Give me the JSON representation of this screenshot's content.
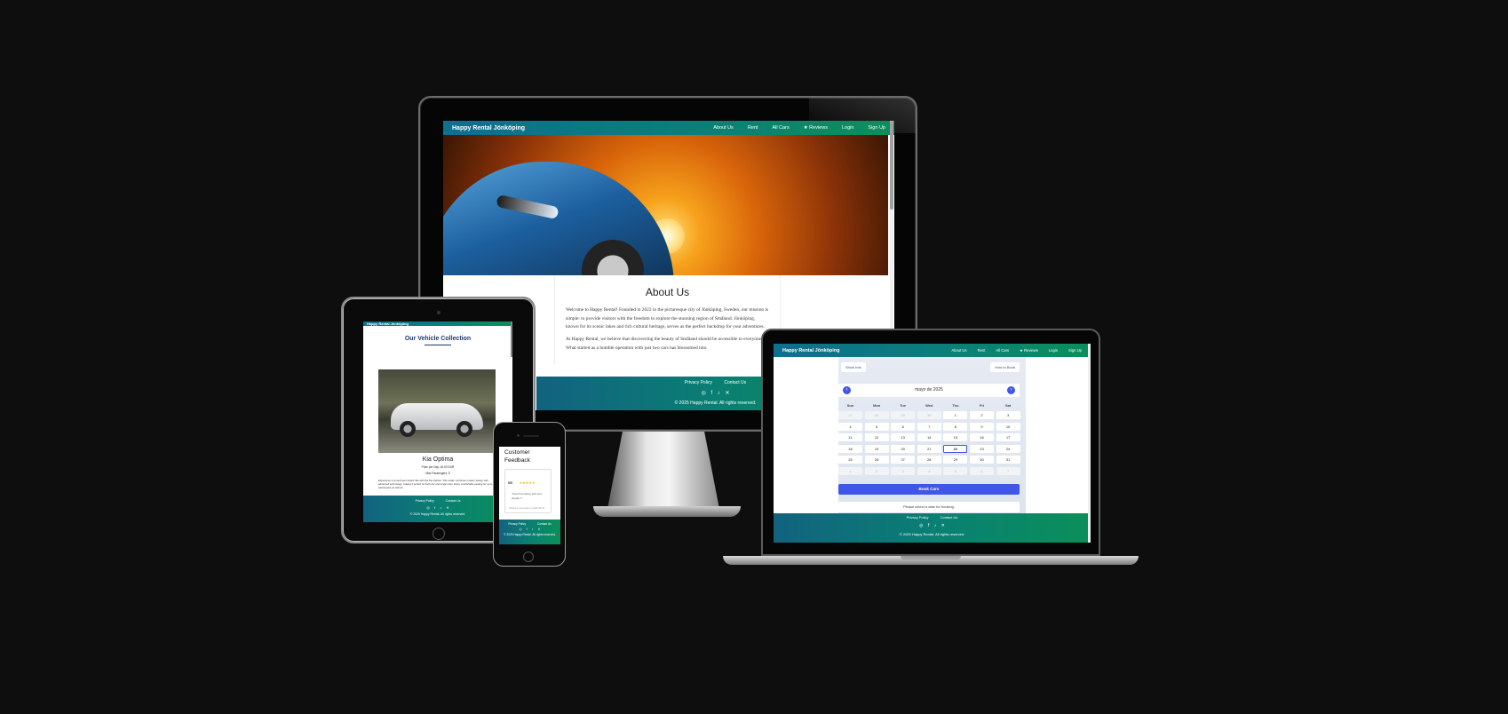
{
  "site": {
    "brand": "Happy Rental Jönköping",
    "nav": [
      "About Us",
      "Rent",
      "All Cars",
      "★ Reviews",
      "Login",
      "Sign Up"
    ],
    "footer": {
      "links": [
        "Privacy Policy",
        "Contact Us"
      ],
      "social_icons": [
        "instagram-icon",
        "facebook-icon",
        "tiktok-icon",
        "twitter-icon"
      ],
      "social_glyphs": [
        "◎",
        "f",
        "♪",
        "✕"
      ],
      "copyright": "© 2025 Happy Rental. All rights reserved."
    },
    "colors": {
      "nav_start": "#0f6f8f",
      "nav_end": "#0b8f5a",
      "accent": "#3f56e6"
    }
  },
  "desktop": {
    "about": {
      "title": "About Us",
      "p1": "Welcome to Happy Rental! Founded in 2022 in the picturesque city of Jönköping, Sweden, our mission is simple: to provide visitors with the freedom to explore the stunning region of Småland. Jönköping, known for its scenic lakes and rich cultural heritage, serves as the perfect backdrop for your adventures.",
      "p2": "At Happy Rental, we believe that discovering the beauty of Småland should be accessible to everyone. What started as a humble operation with just two cars has blossomed into"
    }
  },
  "tablet": {
    "section_title": "Our Vehicle Collection",
    "car_name": "Kia Optima",
    "price_line": "Price per Day: 40.00 EUR",
    "passengers_line": "Max Passengers: 5",
    "description": "Experience a smooth and stylish ride with the Kia Optima. This sedan combines modern design with advanced technology, making it perfect for both city and longer trips. Enjoy comfortable seating for up to 5 passengers as well as"
  },
  "phone": {
    "section_title": "Customer Feedback",
    "rating_value": "5/5",
    "stars": "★★★★★",
    "quote": "\"Good Company and nice people !!\"",
    "meta": "Posted by kusmarin on 2025-05-01"
  },
  "laptop": {
    "buttons": {
      "info": "Show Info",
      "how": "How to Book"
    },
    "month_label": "mayo de 2025",
    "weekdays": [
      "Sun",
      "Mon",
      "Tue",
      "Wed",
      "Thu",
      "Fri",
      "Sat"
    ],
    "weeks": [
      [
        "27",
        "28",
        "29",
        "30",
        "1",
        "2",
        "3"
      ],
      [
        "4",
        "5",
        "6",
        "7",
        "8",
        "9",
        "10"
      ],
      [
        "11",
        "12",
        "13",
        "14",
        "15",
        "16",
        "17"
      ],
      [
        "18",
        "19",
        "20",
        "21",
        "22",
        "23",
        "24"
      ],
      [
        "25",
        "26",
        "27",
        "28",
        "29",
        "30",
        "31"
      ],
      [
        "1",
        "2",
        "3",
        "4",
        "5",
        "6",
        "7"
      ]
    ],
    "today": "22",
    "book_button": "Book Cars",
    "status_message": "Please select a date for booking."
  }
}
